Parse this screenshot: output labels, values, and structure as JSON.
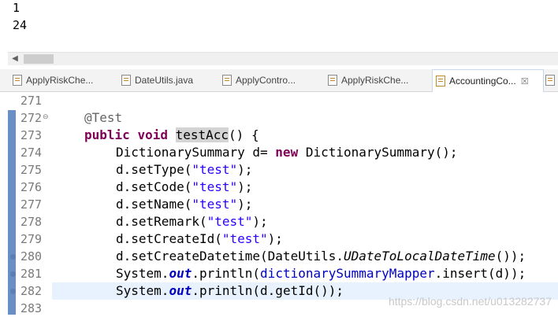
{
  "console": {
    "lines": [
      "1",
      "24"
    ]
  },
  "tabs": [
    {
      "label": "ApplyRiskChe..."
    },
    {
      "label": "DateUtils.java"
    },
    {
      "label": "ApplyContro..."
    },
    {
      "label": "ApplyRiskChe..."
    },
    {
      "label": "AccountingCo...",
      "close": "☒"
    },
    {
      "label": ""
    }
  ],
  "editor": {
    "lines": [
      {
        "n": "271"
      },
      {
        "n": "272",
        "fold": "⊖",
        "t0": "@Test"
      },
      {
        "n": "273",
        "t0": "public",
        "t1": " ",
        "t2": "void",
        "t3": " ",
        "t4": "testAcc",
        "t5": "() {"
      },
      {
        "n": "274",
        "t0": "DictionarySummary d= ",
        "t1": "new",
        "t2": " DictionarySummary();"
      },
      {
        "n": "275",
        "t0": "d",
        "t1": ".setType(",
        "t2": "\"test\"",
        "t3": ");"
      },
      {
        "n": "276",
        "t0": "d",
        "t1": ".setCode(",
        "t2": "\"test\"",
        "t3": ");"
      },
      {
        "n": "277",
        "t0": "d",
        "t1": ".setName(",
        "t2": "\"test\"",
        "t3": ");"
      },
      {
        "n": "278",
        "t0": "d",
        "t1": ".setRemark(",
        "t2": "\"test\"",
        "t3": ");"
      },
      {
        "n": "279",
        "t0": "d",
        "t1": ".setCreateId(",
        "t2": "\"test\"",
        "t3": ");"
      },
      {
        "n": "280",
        "t0": "d",
        "t1": ".setCreateDatetime(DateUtils.",
        "t2": "UDateToLocalDateTime",
        "t3": "());"
      },
      {
        "n": "281",
        "t0": "System.",
        "t1": "out",
        "t2": ".println(",
        "t3": "dictionarySummaryMapper",
        "t4": ".insert(d));"
      },
      {
        "n": "282",
        "t0": "System.",
        "t1": "out",
        "t2": ".println(d.getId());"
      },
      {
        "n": "283"
      }
    ]
  },
  "watermark": "https://blog.csdn.net/u013282737"
}
